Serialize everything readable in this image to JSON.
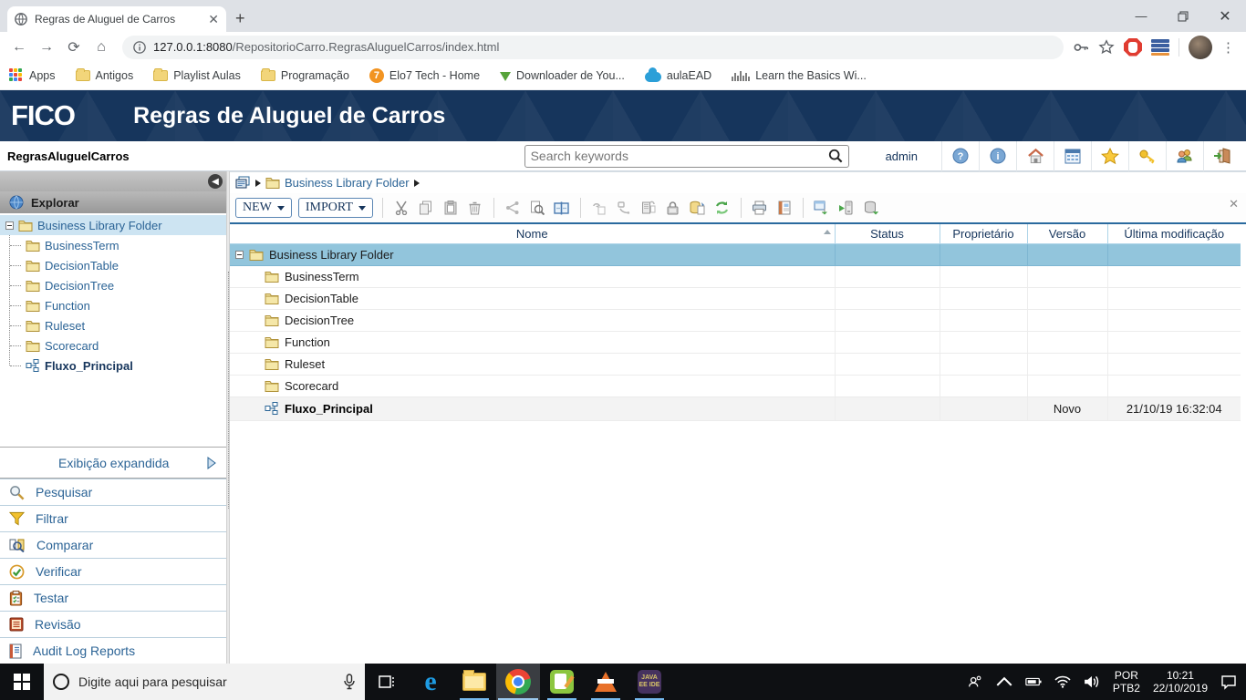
{
  "browser": {
    "tab_title": "Regras de Aluguel de Carros",
    "url_host": "127.0.0.1:8080",
    "url_path": "/RepositorioCarro.RegrasAluguelCarros/index.html",
    "bookmarks": [
      {
        "label": "Apps",
        "icon": "apps-grid-icon"
      },
      {
        "label": "Antigos",
        "icon": "folder-icon"
      },
      {
        "label": "Playlist Aulas",
        "icon": "folder-icon"
      },
      {
        "label": "Programação",
        "icon": "folder-icon"
      },
      {
        "label": "Elo7 Tech - Home",
        "icon": "elo7-icon"
      },
      {
        "label": "Downloader de You...",
        "icon": "download-arrow-icon"
      },
      {
        "label": "aulaEAD",
        "icon": "cloud-icon"
      },
      {
        "label": "Learn the Basics Wi...",
        "icon": "cisco-icon"
      }
    ]
  },
  "app": {
    "brand": "FICO",
    "title": "Regras de Aluguel de Carros",
    "project_name": "RegrasAluguelCarros",
    "search_placeholder": "Search keywords",
    "user": "admin",
    "header_icons": [
      "help-icon",
      "info-icon",
      "home-icon",
      "calendar-icon",
      "favorites-star-icon",
      "key-icon",
      "users-icon",
      "logout-icon"
    ]
  },
  "sidebar": {
    "explore_label": "Explorar",
    "tree": {
      "root": "Business Library Folder",
      "children": [
        "BusinessTerm",
        "DecisionTable",
        "DecisionTree",
        "Function",
        "Ruleset",
        "Scorecard"
      ],
      "flow": "Fluxo_Principal"
    },
    "expanded_view_label": "Exibição expandida",
    "actions": [
      "Pesquisar",
      "Filtrar",
      "Comparar",
      "Verificar",
      "Testar",
      "Revisão",
      "Audit Log Reports"
    ]
  },
  "main": {
    "breadcrumb": "Business Library Folder",
    "toolbar": {
      "new_label": "NEW",
      "import_label": "IMPORT",
      "icons": [
        "cut-icon",
        "copy-icon",
        "paste-icon",
        "delete-icon",
        "share-icon",
        "preview-icon",
        "properties-icon",
        "undo-checkout-icon",
        "checkout-icon",
        "checkin-icon",
        "lock-icon",
        "db-update-icon",
        "refresh-icon",
        "print-icon",
        "report-icon",
        "export-icon",
        "deploy-icon",
        "db-export-icon",
        "close-icon"
      ]
    },
    "table": {
      "columns": [
        "Nome",
        "Status",
        "Proprietário",
        "Versão",
        "Última modificação"
      ],
      "rows": [
        {
          "name": "Business Library Folder",
          "status": "",
          "owner": "",
          "version": "",
          "modified": ""
        },
        {
          "name": "BusinessTerm",
          "status": "",
          "owner": "",
          "version": "",
          "modified": ""
        },
        {
          "name": "DecisionTable",
          "status": "",
          "owner": "",
          "version": "",
          "modified": ""
        },
        {
          "name": "DecisionTree",
          "status": "",
          "owner": "",
          "version": "",
          "modified": ""
        },
        {
          "name": "Function",
          "status": "",
          "owner": "",
          "version": "",
          "modified": ""
        },
        {
          "name": "Ruleset",
          "status": "",
          "owner": "",
          "version": "",
          "modified": ""
        },
        {
          "name": "Scorecard",
          "status": "",
          "owner": "",
          "version": "",
          "modified": ""
        },
        {
          "name": "Fluxo_Principal",
          "status": "",
          "owner": "",
          "version": "Novo",
          "modified": "21/10/19 16:32:04"
        }
      ]
    }
  },
  "taskbar": {
    "search_placeholder": "Digite aqui para pesquisar",
    "lang_line1": "POR",
    "lang_line2": "PTB2",
    "time": "10:21",
    "date": "22/10/2019"
  }
}
